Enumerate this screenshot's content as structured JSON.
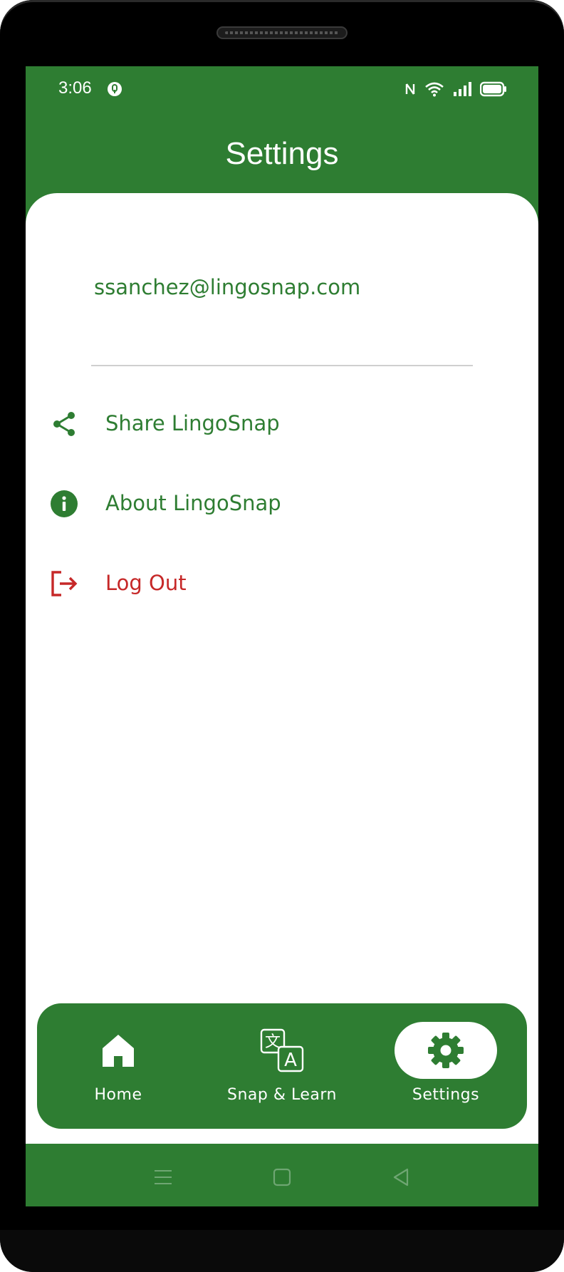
{
  "status_bar": {
    "time": "3:06",
    "icons": [
      "app-notification-icon",
      "nfc-icon",
      "wifi-icon",
      "signal-icon",
      "battery-icon"
    ]
  },
  "header": {
    "title": "Settings"
  },
  "account": {
    "email": "ssanchez@lingosnap.com"
  },
  "menu": [
    {
      "label": "Share LingoSnap",
      "icon": "share-icon"
    },
    {
      "label": "About LingoSnap",
      "icon": "info-icon"
    },
    {
      "label": "Log Out",
      "icon": "logout-icon"
    }
  ],
  "bottom_nav": [
    {
      "label": "Home",
      "icon": "home-icon",
      "active": false
    },
    {
      "label": "Snap & Learn",
      "icon": "translate-icon",
      "active": false
    },
    {
      "label": "Settings",
      "icon": "gear-icon",
      "active": true
    }
  ],
  "system_nav": [
    "menu-icon",
    "home-square-icon",
    "back-icon"
  ],
  "colors": {
    "primary": "#2e7d32",
    "danger": "#c62828",
    "surface": "#ffffff",
    "divider": "#cfcfcf"
  }
}
